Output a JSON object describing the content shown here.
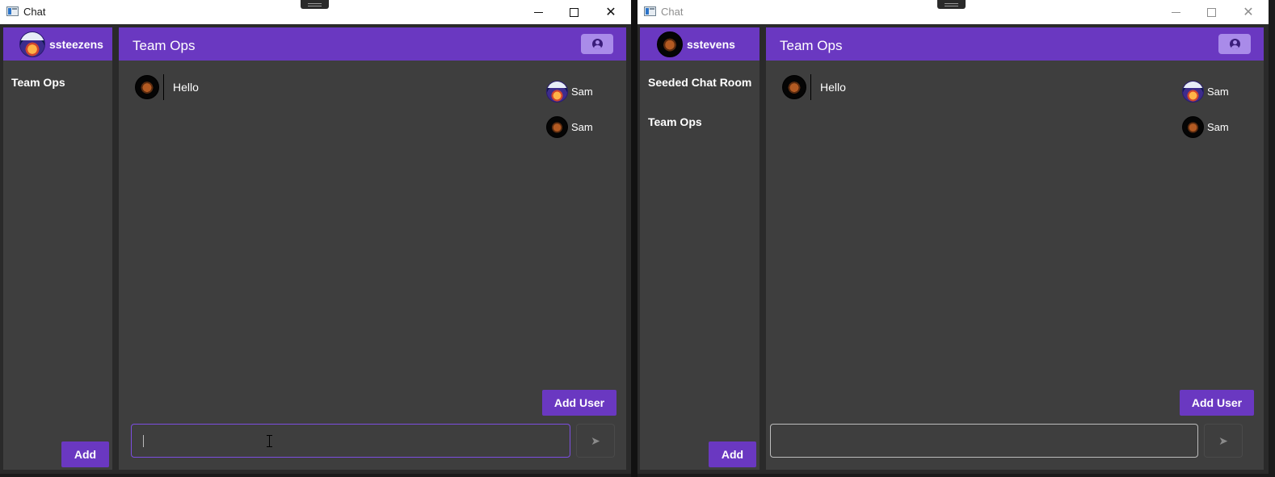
{
  "left_window": {
    "title": "Chat",
    "user": {
      "name": "ssteezens",
      "avatar": "sunset-avatar"
    },
    "rooms": [
      {
        "label": "Team Ops"
      }
    ],
    "add_label": "Add",
    "room_title": "Team Ops",
    "messages": [
      {
        "text": "Hello",
        "avatar": "spider-avatar"
      }
    ],
    "members": [
      {
        "name": "Sam",
        "avatar": "sunset-avatar"
      },
      {
        "name": "Sam",
        "avatar": "spider-avatar"
      }
    ],
    "add_user_label": "Add User",
    "composer": {
      "value": "",
      "focused": true
    },
    "send_icon": "send-icon",
    "account_icon": "account-circle-icon"
  },
  "right_window": {
    "title": "Chat",
    "user": {
      "name": "sstevens",
      "avatar": "spider-avatar"
    },
    "rooms": [
      {
        "label": "Seeded Chat Room"
      },
      {
        "label": "Team Ops"
      }
    ],
    "add_label": "Add",
    "room_title": "Team Ops",
    "messages": [
      {
        "text": "Hello",
        "avatar": "spider-avatar"
      }
    ],
    "members": [
      {
        "name": "Sam",
        "avatar": "sunset-avatar"
      },
      {
        "name": "Sam",
        "avatar": "spider-avatar"
      }
    ],
    "add_user_label": "Add User",
    "composer": {
      "value": "",
      "focused": false
    },
    "send_icon": "send-icon",
    "account_icon": "account-circle-icon"
  },
  "colors": {
    "accent": "#6a38c1",
    "accent_light": "#a98be9",
    "panel": "#3e3e3e",
    "background": "#2a2a2a",
    "text": "#ffffff",
    "focus_border": "#7c4ee0"
  }
}
